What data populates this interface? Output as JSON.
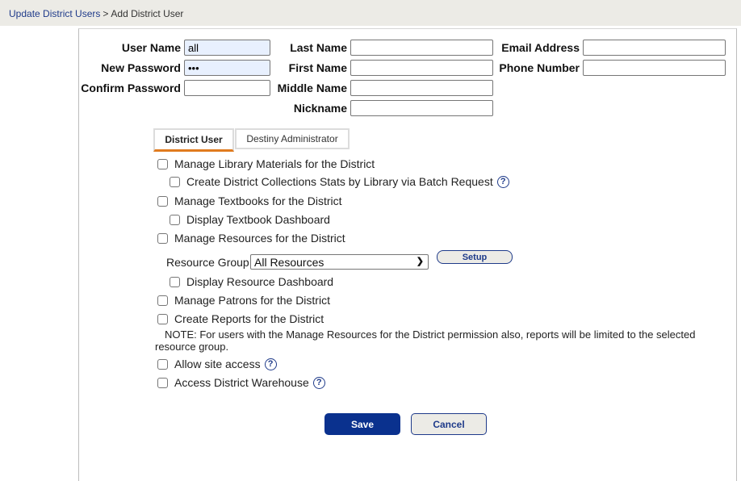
{
  "breadcrumb": {
    "parent": "Update District Users",
    "separator": ">",
    "current": "Add District User"
  },
  "form": {
    "user_name": {
      "label": "User Name",
      "value": "all"
    },
    "new_password": {
      "label": "New Password",
      "value": "•••"
    },
    "confirm_password": {
      "label": "Confirm Password",
      "value": ""
    },
    "last_name": {
      "label": "Last Name",
      "value": ""
    },
    "first_name": {
      "label": "First Name",
      "value": ""
    },
    "middle_name": {
      "label": "Middle Name",
      "value": ""
    },
    "nickname": {
      "label": "Nickname",
      "value": ""
    },
    "email": {
      "label": "Email Address",
      "value": ""
    },
    "phone": {
      "label": "Phone Number",
      "value": ""
    }
  },
  "tabs": [
    {
      "label": "District User",
      "active": true
    },
    {
      "label": "Destiny Administrator",
      "active": false
    }
  ],
  "permissions": {
    "manage_library": "Manage Library Materials for the District",
    "collection_stats": "Create District Collections Stats by Library via Batch Request",
    "manage_textbooks": "Manage Textbooks for the District",
    "textbook_dashboard": "Display Textbook Dashboard",
    "manage_resources": "Manage Resources for the District",
    "resource_group_label": "Resource Group:",
    "resource_group_value": "All Resources",
    "setup_label": "Setup",
    "resource_dashboard": "Display Resource Dashboard",
    "manage_patrons": "Manage Patrons for the District",
    "create_reports": "Create Reports for the District",
    "note": "NOTE: For users with the Manage Resources for the District permission also, reports will be limited to the selected resource group.",
    "allow_site_access": "Allow site access",
    "district_warehouse": "Access District Warehouse"
  },
  "icons": {
    "help": "?",
    "chevron": "⌄"
  },
  "actions": {
    "save": "Save",
    "cancel": "Cancel"
  }
}
